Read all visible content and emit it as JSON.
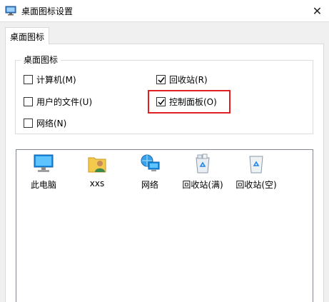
{
  "window": {
    "title": "桌面图标设置",
    "close_glyph": "✕"
  },
  "tabs": [
    {
      "label": "桌面图标"
    }
  ],
  "group": {
    "label": "桌面图标",
    "checkboxes": [
      {
        "label": "计算机(M)",
        "checked": false
      },
      {
        "label": "回收站(R)",
        "checked": true
      },
      {
        "label": "用户的文件(U)",
        "checked": false
      },
      {
        "label": "控制面板(O)",
        "checked": true
      },
      {
        "label": "网络(N)",
        "checked": false
      }
    ]
  },
  "icons": [
    {
      "label": "此电脑",
      "icon": "computer-icon"
    },
    {
      "label": "xxs",
      "icon": "user-folder-icon"
    },
    {
      "label": "网络",
      "icon": "network-icon"
    },
    {
      "label": "回收站(满)",
      "icon": "recycle-bin-full-icon"
    },
    {
      "label": "回收站(空)",
      "icon": "recycle-bin-empty-icon"
    }
  ],
  "colors": {
    "highlight": "#e02020",
    "selection_accent": "#0078d7"
  }
}
